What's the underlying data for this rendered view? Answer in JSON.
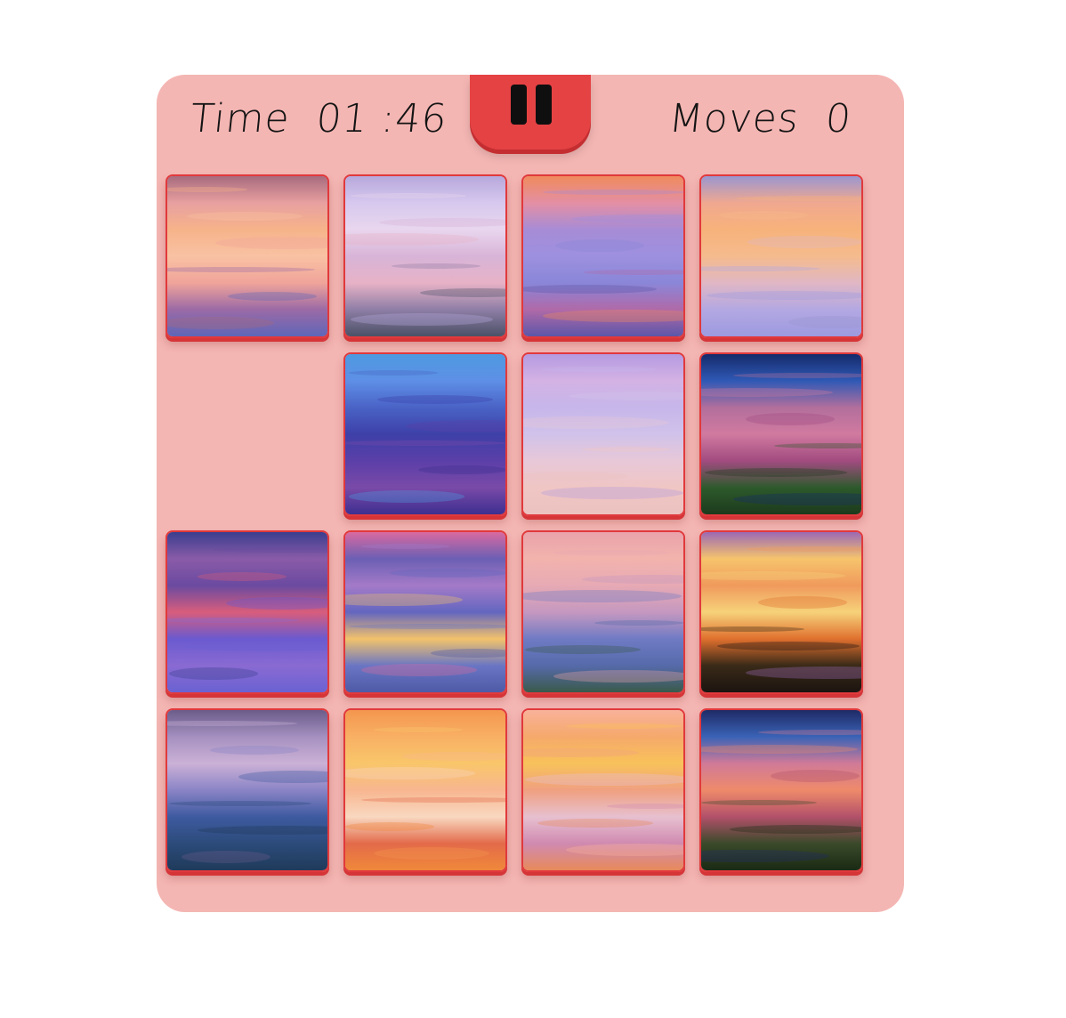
{
  "hud": {
    "time_label": "Time",
    "time_value": "01 :46",
    "moves_label": "Moves",
    "moves_value": "0"
  },
  "pause": {
    "icon": "pause-icon"
  },
  "grid": {
    "rows": 4,
    "cols": 4,
    "empty": [
      1,
      0
    ]
  },
  "tiles": [
    {
      "row": 0,
      "col": 0,
      "g": [
        "#a76b7e",
        "#e8a0a0",
        "#f6b38a",
        "#f9c2a3",
        "#f0a49a",
        "#9b6aa6",
        "#5f66b8"
      ]
    },
    {
      "row": 0,
      "col": 1,
      "g": [
        "#b7a8dc",
        "#d6c8ee",
        "#e9d6ee",
        "#d8b4d8",
        "#e7b2c6",
        "#8e7ea6",
        "#4b5166"
      ]
    },
    {
      "row": 0,
      "col": 2,
      "g": [
        "#f08a5c",
        "#e48fa4",
        "#a78cd6",
        "#9d90df",
        "#8a86d8",
        "#b06aa8",
        "#5c56a8"
      ]
    },
    {
      "row": 0,
      "col": 3,
      "g": [
        "#9a96d0",
        "#f0a890",
        "#f7b27b",
        "#f5bb8d",
        "#e0b7c4",
        "#b3a8e2",
        "#9d9ae0"
      ]
    },
    {
      "row": 1,
      "col": 1,
      "g": [
        "#4d9ae0",
        "#5e8fe6",
        "#4a63c6",
        "#3d40a8",
        "#5b3fa8",
        "#7a4aa8",
        "#3c2f90"
      ]
    },
    {
      "row": 1,
      "col": 2,
      "g": [
        "#b49ae0",
        "#d4b2e4",
        "#c6b6ea",
        "#d0c2ea",
        "#e7c8d8",
        "#f0c6c4",
        "#ecc2c0"
      ]
    },
    {
      "row": 1,
      "col": 3,
      "g": [
        "#152a6a",
        "#2f59b6",
        "#b26f9c",
        "#d17aa0",
        "#a14b80",
        "#2d5a2c",
        "#1d3a1c"
      ]
    },
    {
      "row": 2,
      "col": 0,
      "g": [
        "#3a3e8e",
        "#8a5ba8",
        "#6a4aa0",
        "#d85d7c",
        "#6a5ad0",
        "#8a6ad2",
        "#6a62d2"
      ]
    },
    {
      "row": 2,
      "col": 1,
      "g": [
        "#d96aa0",
        "#6b5fb4",
        "#a47ac8",
        "#6366c0",
        "#f2c26b",
        "#6a76c4",
        "#4e5aa6"
      ]
    },
    {
      "row": 2,
      "col": 2,
      "g": [
        "#e9a2aa",
        "#f2b3ad",
        "#e7aab4",
        "#c598c0",
        "#6f7bc4",
        "#566aaa",
        "#3a5a4a"
      ]
    },
    {
      "row": 2,
      "col": 3,
      "g": [
        "#9c6ab4",
        "#f6c46c",
        "#f09a5c",
        "#f6d27a",
        "#e0702e",
        "#3a2a18",
        "#1c1410"
      ]
    },
    {
      "row": 3,
      "col": 0,
      "g": [
        "#6a5c8a",
        "#a590c0",
        "#cbb1d6",
        "#8a84c6",
        "#3e5aa0",
        "#2c4b7a",
        "#1f3a5a"
      ]
    },
    {
      "row": 3,
      "col": 1,
      "g": [
        "#f4964e",
        "#f8b064",
        "#f9c66a",
        "#f8b690",
        "#f8d8c0",
        "#e36a4a",
        "#f0883a"
      ]
    },
    {
      "row": 3,
      "col": 2,
      "g": [
        "#f8b29a",
        "#f6a96b",
        "#f8c25a",
        "#f0a080",
        "#e7c0d0",
        "#d08ab0",
        "#e88a5a"
      ]
    },
    {
      "row": 3,
      "col": 3,
      "g": [
        "#1f2a66",
        "#3a63b6",
        "#d07a98",
        "#ee8a6a",
        "#b2506a",
        "#3a4a2a",
        "#1a2a14"
      ]
    }
  ]
}
